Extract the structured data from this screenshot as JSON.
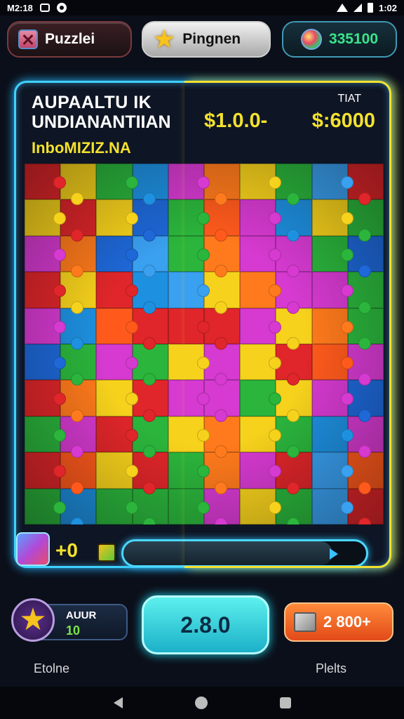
{
  "status": {
    "time": "M2:18",
    "clock": "1:02"
  },
  "topbar": {
    "puzzle_label": "Puzzlei",
    "pingnen_label": "Pingnen",
    "coins": "335100"
  },
  "board": {
    "title_line1": "AUPAALTU IK",
    "title_line2": "UNDIANANTIIAN",
    "subtitle": "InboMIZIZ.NA",
    "tiat_label": "TIAT",
    "value1": "$1.0.0-",
    "value2": "$:6000",
    "progress_plus": "+0",
    "progress_fraction": 0.86
  },
  "bottom": {
    "score_label": "AUUR",
    "score_value": "10",
    "main_button": "2.8.0",
    "orange_button": "2 800+",
    "left_label": "Etolne",
    "right_label": "Plelts"
  },
  "colors": {
    "accent_cyan": "#3ed1ff",
    "accent_yellow": "#f4e12e",
    "coin_green": "#39e58a"
  },
  "puzzle_colors": [
    "#e0262a",
    "#f7d21c",
    "#2bb53c",
    "#1e90e0",
    "#d63ad0",
    "#ff7a1c",
    "#f7d21c",
    "#2bb53c",
    "#3aa0f0",
    "#e0262a",
    "#f7d21c",
    "#e0262a",
    "#f7d21c",
    "#1e68d8",
    "#2bb53c",
    "#ff5a1c",
    "#d63ad0",
    "#1e90e0",
    "#f7d21c",
    "#2bb53c",
    "#d63ad0",
    "#ff7a1c",
    "#1e68d8",
    "#3aa0f0",
    "#2bb53c",
    "#ff7a1c",
    "#d63ad0",
    "#d63ad0",
    "#2bb53c",
    "#1e68d8",
    "#e0262a",
    "#f7d21c",
    "#e0262a",
    "#1e90e0",
    "#3aa0f0",
    "#f7d21c",
    "#ff7a1c",
    "#d63ad0",
    "#d63ad0",
    "#2bb53c",
    "#d63ad0",
    "#1e90e0",
    "#ff5a1c",
    "#e0262a",
    "#e0262a",
    "#e0262a",
    "#d63ad0",
    "#f7d21c",
    "#ff7a1c",
    "#2bb53c",
    "#1e68d8",
    "#2bb53c",
    "#d63ad0",
    "#2bb53c",
    "#f7d21c",
    "#d63ad0",
    "#f7d21c",
    "#e0262a",
    "#ff5a1c",
    "#d63ad0",
    "#e0262a",
    "#ff7a1c",
    "#f7d21c",
    "#e0262a",
    "#d63ad0",
    "#d63ad0",
    "#2bb53c",
    "#f7d21c",
    "#d63ad0",
    "#1e68d8",
    "#2bb53c",
    "#d63ad0",
    "#e0262a",
    "#2bb53c",
    "#f7d21c",
    "#ff7a1c",
    "#f7d21c",
    "#2bb53c",
    "#1e90e0",
    "#d63ad0",
    "#e0262a",
    "#ff5a1c",
    "#f7d21c",
    "#e0262a",
    "#2bb53c",
    "#ff7a1c",
    "#d63ad0",
    "#e0262a",
    "#3aa0f0",
    "#ff5a1c",
    "#2bb53c",
    "#1e90e0",
    "#2bb53c",
    "#2bb53c",
    "#2bb53c",
    "#d63ad0",
    "#f7d21c",
    "#2bb53c",
    "#3aa0f0",
    "#e0262a"
  ]
}
